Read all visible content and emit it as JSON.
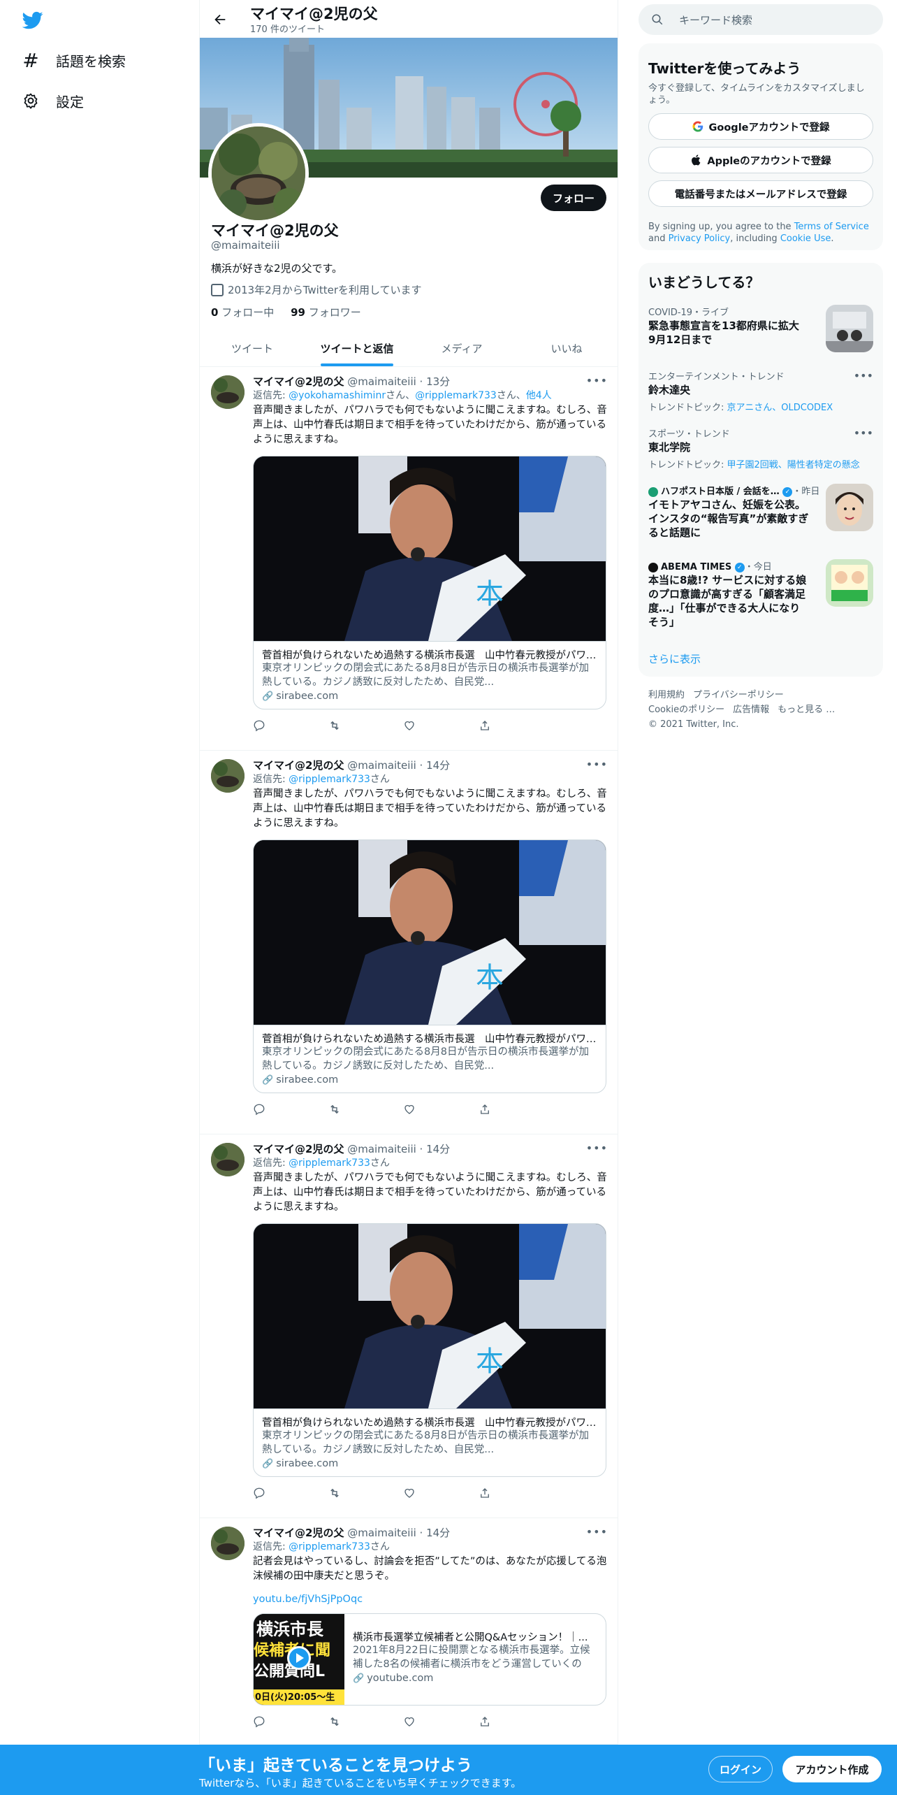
{
  "nav": {
    "explore_label": "話題を検索",
    "settings_label": "設定"
  },
  "profile": {
    "display_name": "マイマイ@2児の父",
    "tweet_count": "170 件のツイート",
    "handle": "@maimaiteiii",
    "bio": "横浜が好きな2児の父です。",
    "joined": "2013年2月からTwitterを利用しています",
    "following_count": "0",
    "following_label": "フォロー中",
    "followers_count": "99",
    "followers_label": "フォロワー",
    "follow_label": "フォロー"
  },
  "tabs": [
    {
      "label": "ツイート"
    },
    {
      "label": "ツイートと返信"
    },
    {
      "label": "メディア"
    },
    {
      "label": "いいね"
    }
  ],
  "tweets": [
    {
      "name": "マイマイ@2児の父",
      "handle": "@maimaiteiii · 13分",
      "reply_prefix": "返信先: ",
      "reply_to_1": "@yokohamashiminr",
      "reply_mid": "さん、",
      "reply_to_2": "@ripplemark733",
      "reply_suffix": "さん、",
      "reply_others": "他4人",
      "text": "音声聞きましたが、パワハラでも何でもないように聞こえますね。むしろ、音声上は、山中竹春氏は期日まで相手を待っていたわけだから、筋が通っているように思えますね。",
      "card_title": "菅首相が負けられないため過熱する横浜市長選　山中竹春元教授がパワハラ疑惑",
      "card_desc": "東京オリンピックの閉会式にあたる8月8日が告示日の横浜市長選挙が加熱している。カジノ誘致に反対したため、自民党...",
      "card_domain": "sirabee.com"
    },
    {
      "name": "マイマイ@2児の父",
      "handle": "@maimaiteiii · 14分",
      "reply_prefix": "返信先: ",
      "reply_to_1": "@ripplemark733",
      "reply_suffix": "さん",
      "text": "音声聞きましたが、パワハラでも何でもないように聞こえますね。むしろ、音声上は、山中竹春氏は期日まで相手を待っていたわけだから、筋が通っているように思えますね。",
      "card_title": "菅首相が負けられないため過熱する横浜市長選　山中竹春元教授がパワハラ疑惑",
      "card_desc": "東京オリンピックの閉会式にあたる8月8日が告示日の横浜市長選挙が加熱している。カジノ誘致に反対したため、自民党...",
      "card_domain": "sirabee.com"
    },
    {
      "name": "マイマイ@2児の父",
      "handle": "@maimaiteiii · 14分",
      "reply_prefix": "返信先: ",
      "reply_to_1": "@ripplemark733",
      "reply_suffix": "さん",
      "text": "音声聞きましたが、パワハラでも何でもないように聞こえますね。むしろ、音声上は、山中竹春氏は期日まで相手を待っていたわけだから、筋が通っているように思えますね。",
      "card_title": "菅首相が負けられないため過熱する横浜市長選　山中竹春元教授がパワハラ疑惑",
      "card_desc": "東京オリンピックの閉会式にあたる8月8日が告示日の横浜市長選挙が加熱している。カジノ誘致に反対したため、自民党...",
      "card_domain": "sirabee.com"
    },
    {
      "name": "マイマイ@2児の父",
      "handle": "@maimaiteiii · 14分",
      "reply_prefix": "返信先: ",
      "reply_to_1": "@ripplemark733",
      "reply_suffix": "さん",
      "text": "記者会見はやっているし、討論会を拒否”してた”のは、あなたが応援してる泡沫候補の田中康夫だと思うぞ。",
      "link": "youtu.be/fjVhSjPpOqc",
      "card_title": "横浜市長選挙立候補者と公開Q&Aセッション！｜...",
      "card_desc": "2021年8月22日に投開票となる横浜市長選挙。立候補した8名の候補者に横浜市をどう運営していくのか...",
      "card_domain": "youtube.com",
      "thumb_lines": [
        "横浜市長",
        "候補者に聞",
        "公開質問L",
        "0日(火)20:05〜生"
      ]
    }
  ],
  "search": {
    "placeholder": "キーワード検索"
  },
  "signup": {
    "title": "Twitterを使ってみよう",
    "subtitle": "今すぐ登録して、タイムラインをカスタマイズしましょう。",
    "google_label": "Googleアカウントで登録",
    "apple_label": "Appleのアカウントで登録",
    "phone_label": "電話番号またはメールアドレスで登録",
    "terms_1": "By signing up, you agree to the ",
    "terms_tos": "Terms of Service",
    "terms_2": " and ",
    "terms_privacy": "Privacy Policy",
    "terms_3": ", including ",
    "terms_cookie": "Cookie Use",
    "terms_4": "."
  },
  "trends": {
    "title": "いまどうしてる？",
    "items": [
      {
        "meta": "COVID-19・ライブ",
        "name": "緊急事態宣言を13都府県に拡大 9月12日まで"
      },
      {
        "meta": "エンターテインメント・トレンド",
        "name": "鈴木達央",
        "sub_prefix": "トレンドトピック: ",
        "sub_links": "京アニさん、OLDCODEX"
      },
      {
        "meta": "スポーツ・トレンド",
        "name": "東北学院",
        "sub_prefix": "トレンドトピック: ",
        "sub_links": "甲子園2回戦、陽性者特定の懸念"
      },
      {
        "meta_source": "ハフポスト日本版 / 会話を…",
        "meta_time": "・昨日",
        "name": "イモトアヤコさん、妊娠を公表。インスタの“報告写真”が素敵すぎると話題に"
      },
      {
        "meta_source": "ABEMA TIMES",
        "meta_time": "・今日",
        "name": "本当に8歳!? サービスに対する娘のプロ意識が高すぎる「顧客満足度…」「仕事ができる大人になりそう」"
      }
    ],
    "show_more": "さらに表示"
  },
  "footer": {
    "links": [
      "利用規約",
      "プライバシーポリシー",
      "Cookieのポリシー",
      "広告情報",
      "もっと見る …"
    ],
    "copyright": "© 2021 Twitter, Inc."
  },
  "bottombar": {
    "title": "「いま」起きていることを見つけよう",
    "subtitle": "Twitterなら、「いま」起きていることをいち早くチェックできます。",
    "login_label": "ログイン",
    "signup_label": "アカウント作成"
  },
  "colors": {
    "accent": "#1d9bf0",
    "text": "#0f1419",
    "muted": "#536471"
  }
}
